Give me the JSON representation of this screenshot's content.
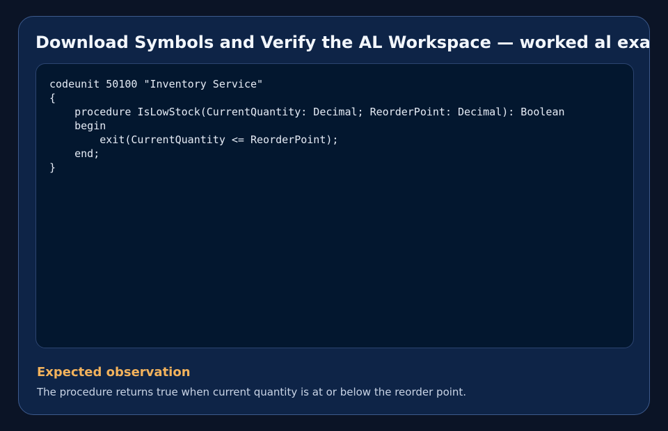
{
  "card": {
    "title": "Download Symbols and Verify the AL Workspace — worked al example",
    "code_lines": [
      "codeunit 50100 \"Inventory Service\"",
      "{",
      "    procedure IsLowStock(CurrentQuantity: Decimal; ReorderPoint: Decimal): Boolean",
      "    begin",
      "        exit(CurrentQuantity <= ReorderPoint);",
      "    end;",
      "}"
    ],
    "observation": {
      "heading": "Expected observation",
      "text": "The procedure returns true when current quantity is at or below the reorder point."
    }
  },
  "colors": {
    "page_background": "#0b1426",
    "card_background": "#0e2447",
    "code_background": "#03172f",
    "accent": "#f2b25c"
  }
}
